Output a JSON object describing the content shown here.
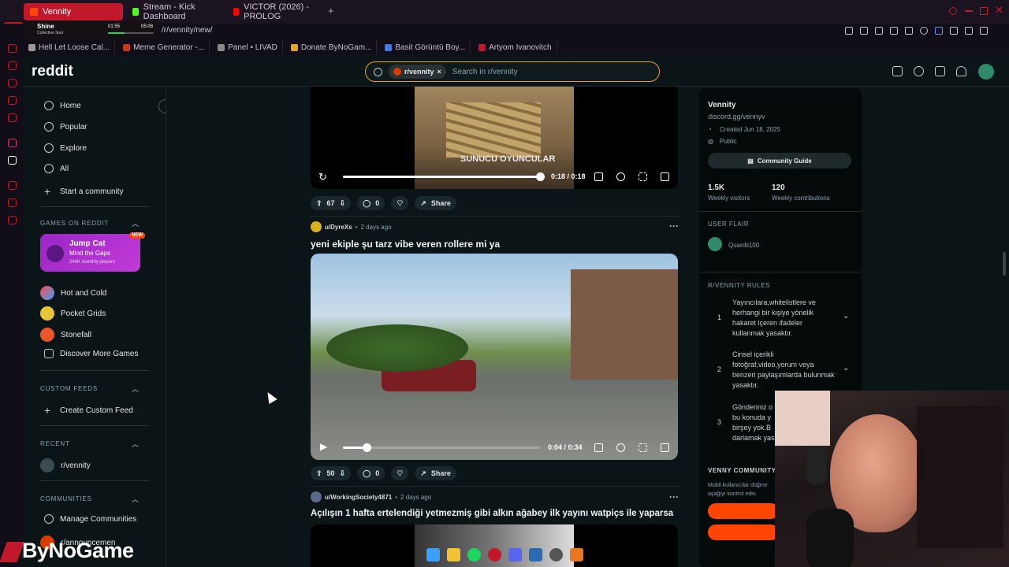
{
  "browser": {
    "tabs": [
      {
        "label": "Vennity",
        "active": true,
        "icon_color": "#ff4500"
      },
      {
        "label": "Stream - Kick Dashboard",
        "active": false,
        "icon_color": "#53fc18"
      },
      {
        "label": "VICTOR (2026) - PROLOG",
        "active": false,
        "icon_color": "#ff0000"
      }
    ],
    "new_tab_label": "+",
    "address": "/r/vennity/new/",
    "bookmarks": [
      {
        "label": "Hell Let Loose Cal...",
        "color": "#9a9a9a"
      },
      {
        "label": "Meme Generator -...",
        "color": "#c23b22"
      },
      {
        "label": "Panel • LIVAD",
        "color": "#8a8a8a"
      },
      {
        "label": "Donate ByNoGam...",
        "color": "#e8a428"
      },
      {
        "label": "Basit Görüntü Boy...",
        "color": "#4a78e0"
      },
      {
        "label": "Artyom Ivanovitch",
        "color": "#c2182b"
      }
    ]
  },
  "music_widget": {
    "title": "Shine",
    "artist": "Collective Soul",
    "elapsed": "01:55",
    "total": "05:08"
  },
  "header": {
    "logo": "reddit",
    "search_chip": "r/vennity",
    "search_chip_close": "×",
    "search_placeholder": "Search in r/vennity"
  },
  "leftnav": {
    "main": [
      "Home",
      "Popular",
      "Explore",
      "All",
      "Start a community"
    ],
    "games_heading": "GAMES ON REDDIT",
    "jumpcat": {
      "title": "Jump Cat",
      "subtitle": "Mind the Gaps",
      "players": "244K monthly players",
      "badge": "NEW"
    },
    "games": [
      "Hot and Cold",
      "Pocket Grids",
      "Stonefall",
      "Discover More Games"
    ],
    "custom_heading": "CUSTOM FEEDS",
    "create_feed": "Create Custom Feed",
    "recent_heading": "RECENT",
    "recent_item": "r/vennity",
    "communities_heading": "COMMUNITIES",
    "manage": "Manage Communities",
    "announce": "r/announcemen"
  },
  "posts": [
    {
      "overlay_text": "SUNUCU OYUNCULAR",
      "time": "0:18 / 0:18",
      "progress": 1.0,
      "votes": "67",
      "comments": "0",
      "share": "Share"
    },
    {
      "user": "u/DyreXs",
      "age": "2 days ago",
      "title": "yeni ekiple şu tarz vibe veren rollere mi ya",
      "time": "0:04 / 0:34",
      "progress": 0.12,
      "votes": "50",
      "comments": "0",
      "share": "Share"
    },
    {
      "user": "u/WorkingSociety4871",
      "age": "2 days ago",
      "title": "Açılışın 1 hafta ertelendiği yetmezmiş gibi alkın ağabey ilk yayını watpiçs ile yaparsa"
    }
  ],
  "post_separator": "•",
  "more_label": "···",
  "rightbar": {
    "name": "Vennity",
    "link": "discord.gg/vennyv",
    "created": "Created Jun 18, 2025",
    "visibility": "Public",
    "guide_button": "Community Guide",
    "weekly_visitors_value": "1.5K",
    "weekly_visitors_label": "Weekly visitors",
    "weekly_contrib_value": "120",
    "weekly_contrib_label": "Weekly contributions",
    "flair_heading": "USER FLAIR",
    "flair_user": "Quardii100",
    "rules_heading": "R/VENNITY RULES",
    "rules": [
      {
        "num": "1",
        "text": "Yayıncılara,whitelistlere ve herhangi bir kişiye yönelik hakaret içeren ifadeler kullanmak yasaktır."
      },
      {
        "num": "2",
        "text": "Cinsel içerikli fotoğraf,video,yorum veya benzeri paylaşımlarda bulunmak yasaktır."
      },
      {
        "num": "3",
        "text": "Gönderiniz o bu konuda y birşey yok.B darlamak yas"
      }
    ],
    "community_heading": "VENNY COMMUNITY S",
    "mobile_note": "Mobil kullanıcılar düğme aşağıyı kontrol edin."
  },
  "watermark": "ByNoGame",
  "colors": {
    "accent": "#ff4500",
    "search_border": "#e8a428",
    "tab_active": "#c2182b"
  }
}
